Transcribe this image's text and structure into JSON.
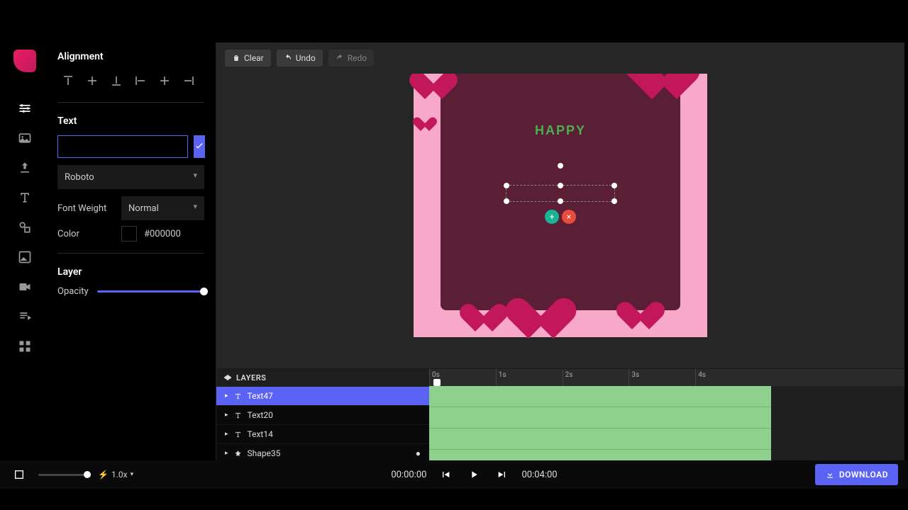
{
  "panel": {
    "alignment_title": "Alignment",
    "text_title": "Text",
    "text_value": "",
    "font_family": "Roboto",
    "font_weight_label": "Font Weight",
    "font_weight_value": "Normal",
    "color_label": "Color",
    "color_value": "#000000",
    "layer_title": "Layer",
    "opacity_label": "Opacity"
  },
  "toolbar": {
    "clear": "Clear",
    "undo": "Undo",
    "redo": "Redo"
  },
  "canvas": {
    "happy_text": "HAPPY"
  },
  "layers": {
    "header": "LAYERS",
    "items": [
      {
        "name": "Text47",
        "type": "text",
        "selected": true
      },
      {
        "name": "Text20",
        "type": "text",
        "selected": false
      },
      {
        "name": "Text14",
        "type": "text",
        "selected": false
      },
      {
        "name": "Shape35",
        "type": "shape",
        "selected": false
      }
    ]
  },
  "timeline": {
    "ticks": [
      "0s",
      "1s",
      "2s",
      "3s",
      "4s"
    ]
  },
  "playback": {
    "speed": "1.0x",
    "current": "00:00:00",
    "total": "00:04:00",
    "download": "DOWNLOAD"
  }
}
